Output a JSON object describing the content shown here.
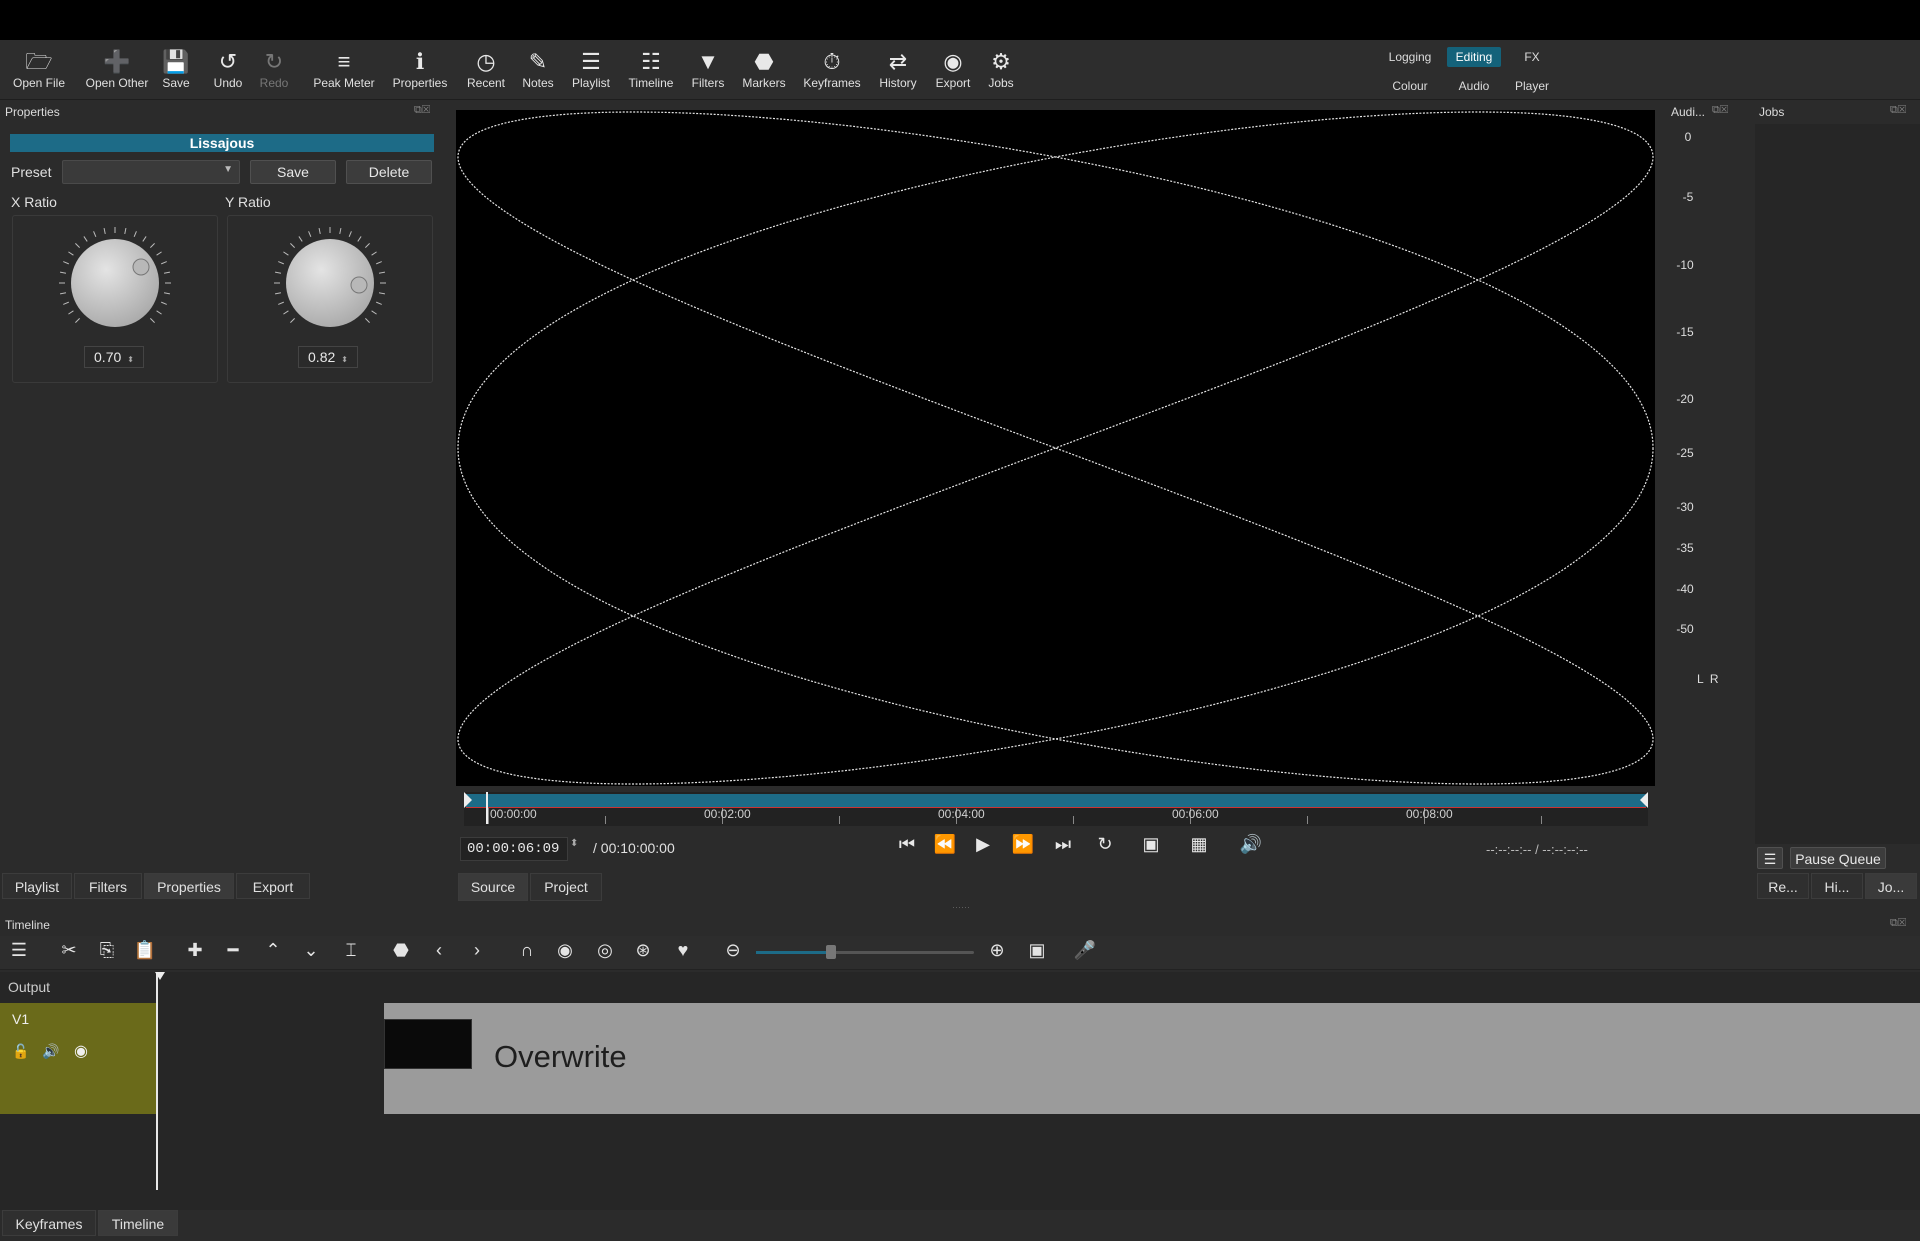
{
  "toolbar": {
    "buttons": [
      {
        "label": "Open File",
        "icon": "folder-open-icon"
      },
      {
        "label": "Open Other",
        "icon": "open-other-icon"
      },
      {
        "label": "Save",
        "icon": "save-icon"
      },
      {
        "label": "Undo",
        "icon": "undo-icon"
      },
      {
        "label": "Redo",
        "icon": "redo-icon"
      },
      {
        "label": "Peak Meter",
        "icon": "peak-meter-icon"
      },
      {
        "label": "Properties",
        "icon": "info-icon"
      },
      {
        "label": "Recent",
        "icon": "clock-icon"
      },
      {
        "label": "Notes",
        "icon": "notes-icon"
      },
      {
        "label": "Playlist",
        "icon": "list-icon"
      },
      {
        "label": "Timeline",
        "icon": "timeline-icon"
      },
      {
        "label": "Filters",
        "icon": "filter-icon"
      },
      {
        "label": "Markers",
        "icon": "marker-icon"
      },
      {
        "label": "Keyframes",
        "icon": "stopwatch-icon"
      },
      {
        "label": "History",
        "icon": "history-icon"
      },
      {
        "label": "Export",
        "icon": "export-disc-icon"
      },
      {
        "label": "Jobs",
        "icon": "gear-icon"
      }
    ],
    "layouts": {
      "logging": "Logging",
      "editing": "Editing",
      "fx": "FX",
      "colour": "Colour",
      "audio": "Audio",
      "player": "Player"
    }
  },
  "properties": {
    "title": "Properties",
    "filter_name": "Lissajous",
    "preset_label": "Preset",
    "preset_value": "",
    "save_label": "Save",
    "delete_label": "Delete",
    "x_ratio_label": "X Ratio",
    "y_ratio_label": "Y Ratio",
    "x_ratio_value": "0.70",
    "y_ratio_value": "0.82"
  },
  "left_tabs": {
    "playlist": "Playlist",
    "filters": "Filters",
    "properties": "Properties",
    "export": "Export"
  },
  "viewer": {
    "ruler_labels": [
      "00:00:00",
      "00:02:00",
      "00:04:00",
      "00:06:00",
      "00:08:00"
    ],
    "timecode": "00:00:06:09",
    "duration": "/ 00:10:00:00",
    "in_out": "--:--:--:-- / --:--:--:--",
    "source_tab": "Source",
    "project_tab": "Project"
  },
  "audio": {
    "title": "Audi...",
    "db_labels": [
      "0",
      "-5",
      "-10",
      "-15",
      "-20",
      "-25",
      "-30",
      "-35",
      "-40",
      "-50"
    ],
    "channels": "L  R"
  },
  "jobs": {
    "title": "Jobs",
    "pause_queue": "Pause Queue",
    "tabs": [
      "Re...",
      "Hi...",
      "Jo..."
    ]
  },
  "timeline": {
    "title": "Timeline",
    "output_label": "Output",
    "track_name": "V1",
    "clip_label": "Overwrite"
  },
  "bottom_tabs": {
    "keyframes": "Keyframes",
    "timeline": "Timeline"
  },
  "colors": {
    "accent": "#1d6b87",
    "track_header": "#6a6a1a",
    "clip": "#9b9b9b"
  }
}
